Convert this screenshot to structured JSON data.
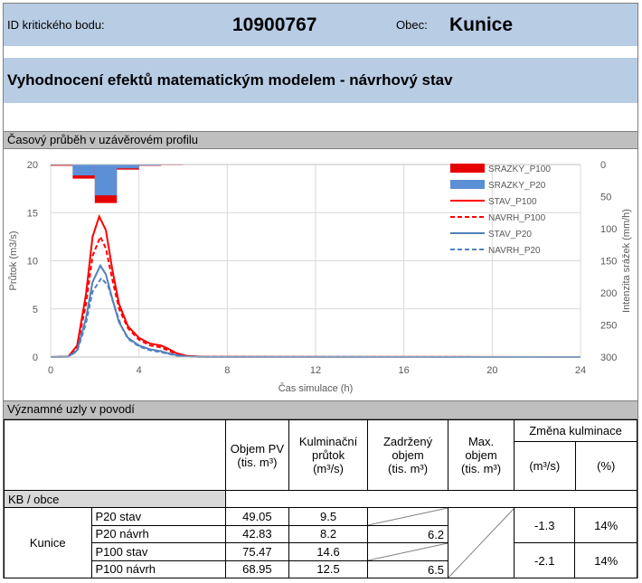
{
  "header": {
    "id_label": "ID kritického bodu:",
    "id_value": "10900767",
    "obec_label": "Obec:",
    "obec_value": "Kunice",
    "title": "Vyhodnocení efektů matematickým modelem - návrhový stav"
  },
  "section_chart_title": "Časový průběh v uzávěrovém profilu",
  "section_nodes_title": "Významné uzly v povodí",
  "colors": {
    "p100": "#ff0000",
    "p20": "#4f81bd",
    "p100_bar": "#e60000",
    "p20_bar": "#5b8fd6",
    "header_bg": "#b8cce4",
    "band_bg": "#bfbfbf"
  },
  "chart_data": {
    "type": "line",
    "xlabel": "Čas simulace (h)",
    "ylabel": "Průtok (m3/s)",
    "y2label": "Intenzita srážek (mm/h)",
    "xlim": [
      0,
      24
    ],
    "ylim": [
      0,
      20
    ],
    "y2lim": [
      0,
      300
    ],
    "xticks": [
      "0",
      "4",
      "8",
      "12",
      "16",
      "20",
      "24"
    ],
    "yticks": [
      "0",
      "5",
      "10",
      "15",
      "20"
    ],
    "y2ticks": [
      "0",
      "50",
      "100",
      "150",
      "200",
      "250",
      "300"
    ],
    "series": [
      {
        "name": "STAV_P100",
        "style": "solid",
        "color": "#ff0000",
        "x": [
          0,
          0.8,
          1.2,
          1.6,
          1.9,
          2.2,
          2.5,
          2.8,
          3.1,
          3.5,
          4,
          4.5,
          5,
          5.3,
          5.7,
          6.2,
          7,
          24
        ],
        "y": [
          0,
          0.05,
          1.2,
          6.5,
          12.5,
          14.6,
          13.2,
          9.0,
          5.5,
          3.2,
          2.0,
          1.4,
          1.2,
          0.9,
          0.4,
          0.1,
          0.02,
          0
        ]
      },
      {
        "name": "NAVRH_P100",
        "style": "dashed",
        "color": "#ff0000",
        "x": [
          0,
          0.8,
          1.2,
          1.6,
          1.9,
          2.25,
          2.5,
          2.8,
          3.1,
          3.5,
          4,
          4.5,
          5,
          5.3,
          5.7,
          6.2,
          7,
          24
        ],
        "y": [
          0,
          0.05,
          1.0,
          5.5,
          10.5,
          12.5,
          11.3,
          8.0,
          5.0,
          3.0,
          1.8,
          1.2,
          1.0,
          0.7,
          0.3,
          0.1,
          0.02,
          0
        ]
      },
      {
        "name": "STAV_P20",
        "style": "solid",
        "color": "#4f81bd",
        "x": [
          0,
          0.8,
          1.2,
          1.6,
          1.9,
          2.25,
          2.5,
          2.8,
          3.1,
          3.5,
          4,
          4.5,
          5,
          5.3,
          5.7,
          6.2,
          7,
          24
        ],
        "y": [
          0,
          0.03,
          0.7,
          4.0,
          7.8,
          9.5,
          8.6,
          6.0,
          3.6,
          2.0,
          1.2,
          0.8,
          0.6,
          0.4,
          0.2,
          0.05,
          0.01,
          0
        ]
      },
      {
        "name": "NAVRH_P20",
        "style": "dashed",
        "color": "#4f81bd",
        "x": [
          0,
          0.8,
          1.2,
          1.6,
          1.9,
          2.3,
          2.6,
          2.9,
          3.2,
          3.5,
          4,
          4.5,
          5,
          5.3,
          5.7,
          6.2,
          7,
          24
        ],
        "y": [
          0,
          0.03,
          0.6,
          3.5,
          6.8,
          8.2,
          7.4,
          5.2,
          3.2,
          1.9,
          1.1,
          0.7,
          0.5,
          0.35,
          0.15,
          0.05,
          0.01,
          0
        ]
      }
    ],
    "bars": [
      {
        "name": "SRAZKY_P100",
        "color": "#e60000",
        "x0": [
          0,
          1,
          2,
          3,
          4,
          5
        ],
        "x1": [
          1,
          2,
          3,
          4,
          5,
          6
        ],
        "y": [
          2,
          22,
          60,
          8,
          2,
          1
        ]
      },
      {
        "name": "SRAZKY_P20",
        "color": "#5b8fd6",
        "x0": [
          0,
          1,
          2,
          3,
          4,
          5
        ],
        "x1": [
          1,
          2,
          3,
          4,
          5,
          6
        ],
        "y": [
          1,
          17,
          48,
          6,
          1.5,
          0.5
        ]
      }
    ],
    "legend": [
      "SRAZKY_P100",
      "SRAZKY_P20",
      "STAV_P100",
      "NAVRH_P100",
      "STAV_P20",
      "NAVRH_P20"
    ],
    "legend_position": "top-right",
    "grid": true
  },
  "table": {
    "col_objem_pv": "Objem PV",
    "col_objem_pv_unit": "(tis. m³)",
    "col_kulm": "Kulminační průtok",
    "col_kulm_unit": "(m³/s)",
    "col_zadrz": "Zadržený objem",
    "col_zadrz_unit": "(tis. m³)",
    "col_max": "Max. objem",
    "col_max_unit": "(tis. m³)",
    "col_zmena": "Změna kulminace",
    "col_zmena_unit1": "(m³/s)",
    "col_zmena_unit2": "(%)",
    "group_label": "KB / obce",
    "node_name": "Kunice",
    "rows": [
      {
        "scenario": "P20 stav",
        "objem": "49.05",
        "kulm": "9.5",
        "zadrz": ""
      },
      {
        "scenario": "P20 návrh",
        "objem": "42.83",
        "kulm": "8.2",
        "zadrz": "6.2"
      },
      {
        "scenario": "P100 stav",
        "objem": "75.47",
        "kulm": "14.6",
        "zadrz": ""
      },
      {
        "scenario": "P100 návrh",
        "objem": "68.95",
        "kulm": "12.5",
        "zadrz": "6.5"
      }
    ],
    "change_p20_abs": "-1.3",
    "change_p20_pct": "14%",
    "change_p100_abs": "-2.1",
    "change_p100_pct": "14%"
  }
}
